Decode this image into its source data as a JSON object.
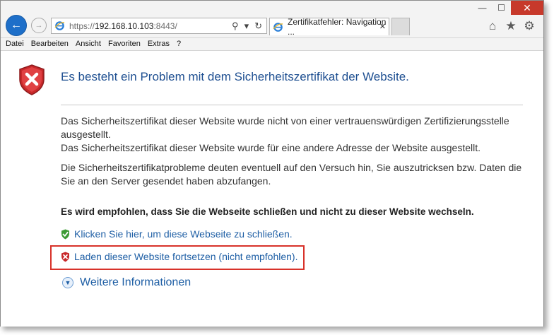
{
  "window": {
    "minimize_glyph": "—",
    "maximize_glyph": "☐",
    "close_glyph": "✕",
    "close_color": "#c7392b"
  },
  "navigation": {
    "back_icon": "back-arrow-icon",
    "forward_icon": "forward-arrow-icon",
    "back_glyph": "←",
    "forward_glyph": "→"
  },
  "address_bar": {
    "scheme": "https://",
    "host": "192.168.10.103",
    "rest": ":8443/",
    "search_glyph": "⚲",
    "dropdown_glyph": "▾",
    "refresh_glyph": "↻"
  },
  "tab": {
    "title": "Zertifikatfehler: Navigation ...",
    "close_glyph": "✕"
  },
  "toolbar_icons": {
    "home_glyph": "⌂",
    "favorites_glyph": "★",
    "settings_glyph": "⚙"
  },
  "menu": [
    "Datei",
    "Bearbeiten",
    "Ansicht",
    "Favoriten",
    "Extras",
    "?"
  ],
  "page": {
    "heading": "Es besteht ein Problem mit dem Sicherheitszertifikat der Website.",
    "paragraph1_line1": "Das Sicherheitszertifikat dieser Website wurde nicht von einer vertrauenswürdigen Zertifizierungsstelle ausgestellt.",
    "paragraph1_line2": "Das Sicherheitszertifikat dieser Website wurde für eine andere Adresse der Website ausgestellt.",
    "paragraph2": "Die Sicherheitszertifikatprobleme deuten eventuell auf den Versuch hin, Sie auszutricksen bzw. Daten die Sie an den Server gesendet haben abzufangen.",
    "recommendation": "Es wird empfohlen, dass Sie die Webseite schließen und nicht zu dieser Website wechseln.",
    "close_link": "Klicken Sie hier, um diese Webseite zu schließen.",
    "continue_link": "Laden dieser Website fortsetzen (nicht empfohlen).",
    "more_info": "Weitere Informationen",
    "more_info_glyph": "▼"
  },
  "colors": {
    "heading": "#1e4f91",
    "link": "#1f5fa5",
    "highlight": "#d8322a",
    "shield_red": "#c8282a",
    "shield_green": "#3d9b35"
  }
}
